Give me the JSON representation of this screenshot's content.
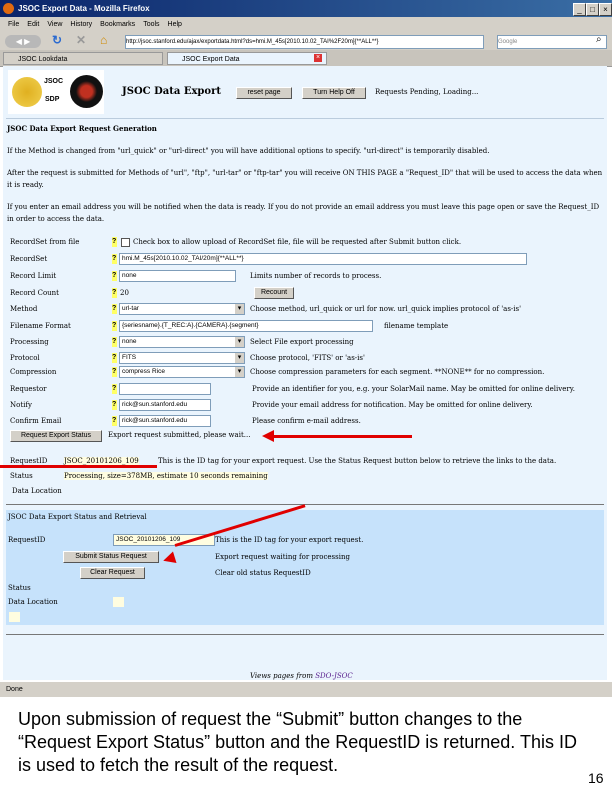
{
  "window": {
    "title": "JSOC Export Data - Mozilla Firefox",
    "min": "_",
    "max": "□",
    "close": "×"
  },
  "menu": [
    "File",
    "Edit",
    "View",
    "History",
    "Bookmarks",
    "Tools",
    "Help"
  ],
  "nav": {
    "url": "http://jsoc.stanford.edu/ajax/exportdata.html?ds=hmi.M_45s[2010.10.02_TAI%2F20m]{**ALL**}",
    "search_placeholder": "Google"
  },
  "tabs": [
    {
      "label": "JSOC Lookdata"
    },
    {
      "label": "JSOC Export Data"
    }
  ],
  "header": {
    "logo_text_1": "JSOC",
    "logo_text_2": "SDP",
    "title": "JSOC Data Export",
    "reset": "reset page",
    "help": "Turn Help Off",
    "status": "Requests Pending, Loading..."
  },
  "gen": {
    "title": "JSOC Data Export Request Generation",
    "p1": "If the Method is changed from \"url_quick\" or \"url-direct\" you will have additional options to specify. \"url-direct\" is temporarily disabled.",
    "p2": "After the request is submitted for Methods of \"url\", \"ftp\", \"url-tar\" or \"ftp-tar\" you will receive ON THIS PAGE a \"Request_ID\" that will be used to access the data when it is ready.",
    "p3": "If you enter an email address you will be notified when the data is ready. If you do not provide an email address you must leave this page open or save the Request_ID in order to access the data."
  },
  "form": [
    {
      "label": "RecordSet from file",
      "value": "",
      "note": "Check box to allow upload of RecordSet file, file will be requested after Submit button click."
    },
    {
      "label": "RecordSet",
      "value": "hmi.M_45s[2010.10.02_TAI/20m]{**ALL**}",
      "note": ""
    },
    {
      "label": "Record Limit",
      "value": "none",
      "note": "Limits number of records to process."
    },
    {
      "label": "Record Count",
      "value": "20",
      "note": "Recount"
    },
    {
      "label": "Method",
      "value": "url-tar",
      "note": "Choose method, url_quick or url for now. url_quick implies protocol of 'as-is'"
    },
    {
      "label": "Filename Format",
      "value": "{seriesname}.{T_REC:A}.{CAMERA}.{segment}",
      "note": "filename template"
    },
    {
      "label": "Processing",
      "value": "none",
      "note": "Select File export processing"
    },
    {
      "label": "Protocol",
      "value": "FITS",
      "note": "Choose protocol, 'FITS' or 'as-is'"
    },
    {
      "label": "Compression",
      "value": "compress Rice",
      "note": "Choose compression parameters for each segment. **NONE** for no compression."
    },
    {
      "label": "Requestor",
      "value": "",
      "note": "Provide an identifier for you, e.g. your SolarMail name. May be omitted for online delivery."
    },
    {
      "label": "Notify",
      "value": "rick@sun.stanford.edu",
      "note": "Provide your email address for notification. May be omitted for online delivery."
    },
    {
      "label": "Confirm Email",
      "value": "rick@sun.stanford.edu",
      "note": "Please confirm e-mail address."
    }
  ],
  "submit": {
    "button": "Request Export Status",
    "message": "Export request submitted, please wait..."
  },
  "result": {
    "id_label": "RequestID",
    "id": "JSOC_20101206_109",
    "id_note": "This is the ID tag for your export request. Use the Status Request button below to retrieve the links to the data.",
    "status_label": "Status",
    "status": "Processing, size=378MB, estimate 10 seconds remaining",
    "loc_label": "Data Location"
  },
  "retrieval": {
    "title": "JSOC Data Export Status and Retrieval",
    "id_label": "RequestID",
    "id_value": "JSOC_20101206_109",
    "id_note": "This is the ID tag for your export request.",
    "submit": "Submit Status Request",
    "submit_note": "Export request waiting for processing",
    "clear": "Clear Request",
    "clear_note": "Clear old status RequestID",
    "status_label": "Status",
    "loc_label": "Data Location"
  },
  "footer": {
    "text": "Views pages from",
    "link": "SDO-JSOC"
  },
  "statusbar": {
    "text": "Done"
  },
  "slide": {
    "caption": "Upon submission of request the “Submit” button changes to the “Request Export Status” button and the RequestID is returned. This ID is used to fetch the result of the request.",
    "page": "16"
  }
}
